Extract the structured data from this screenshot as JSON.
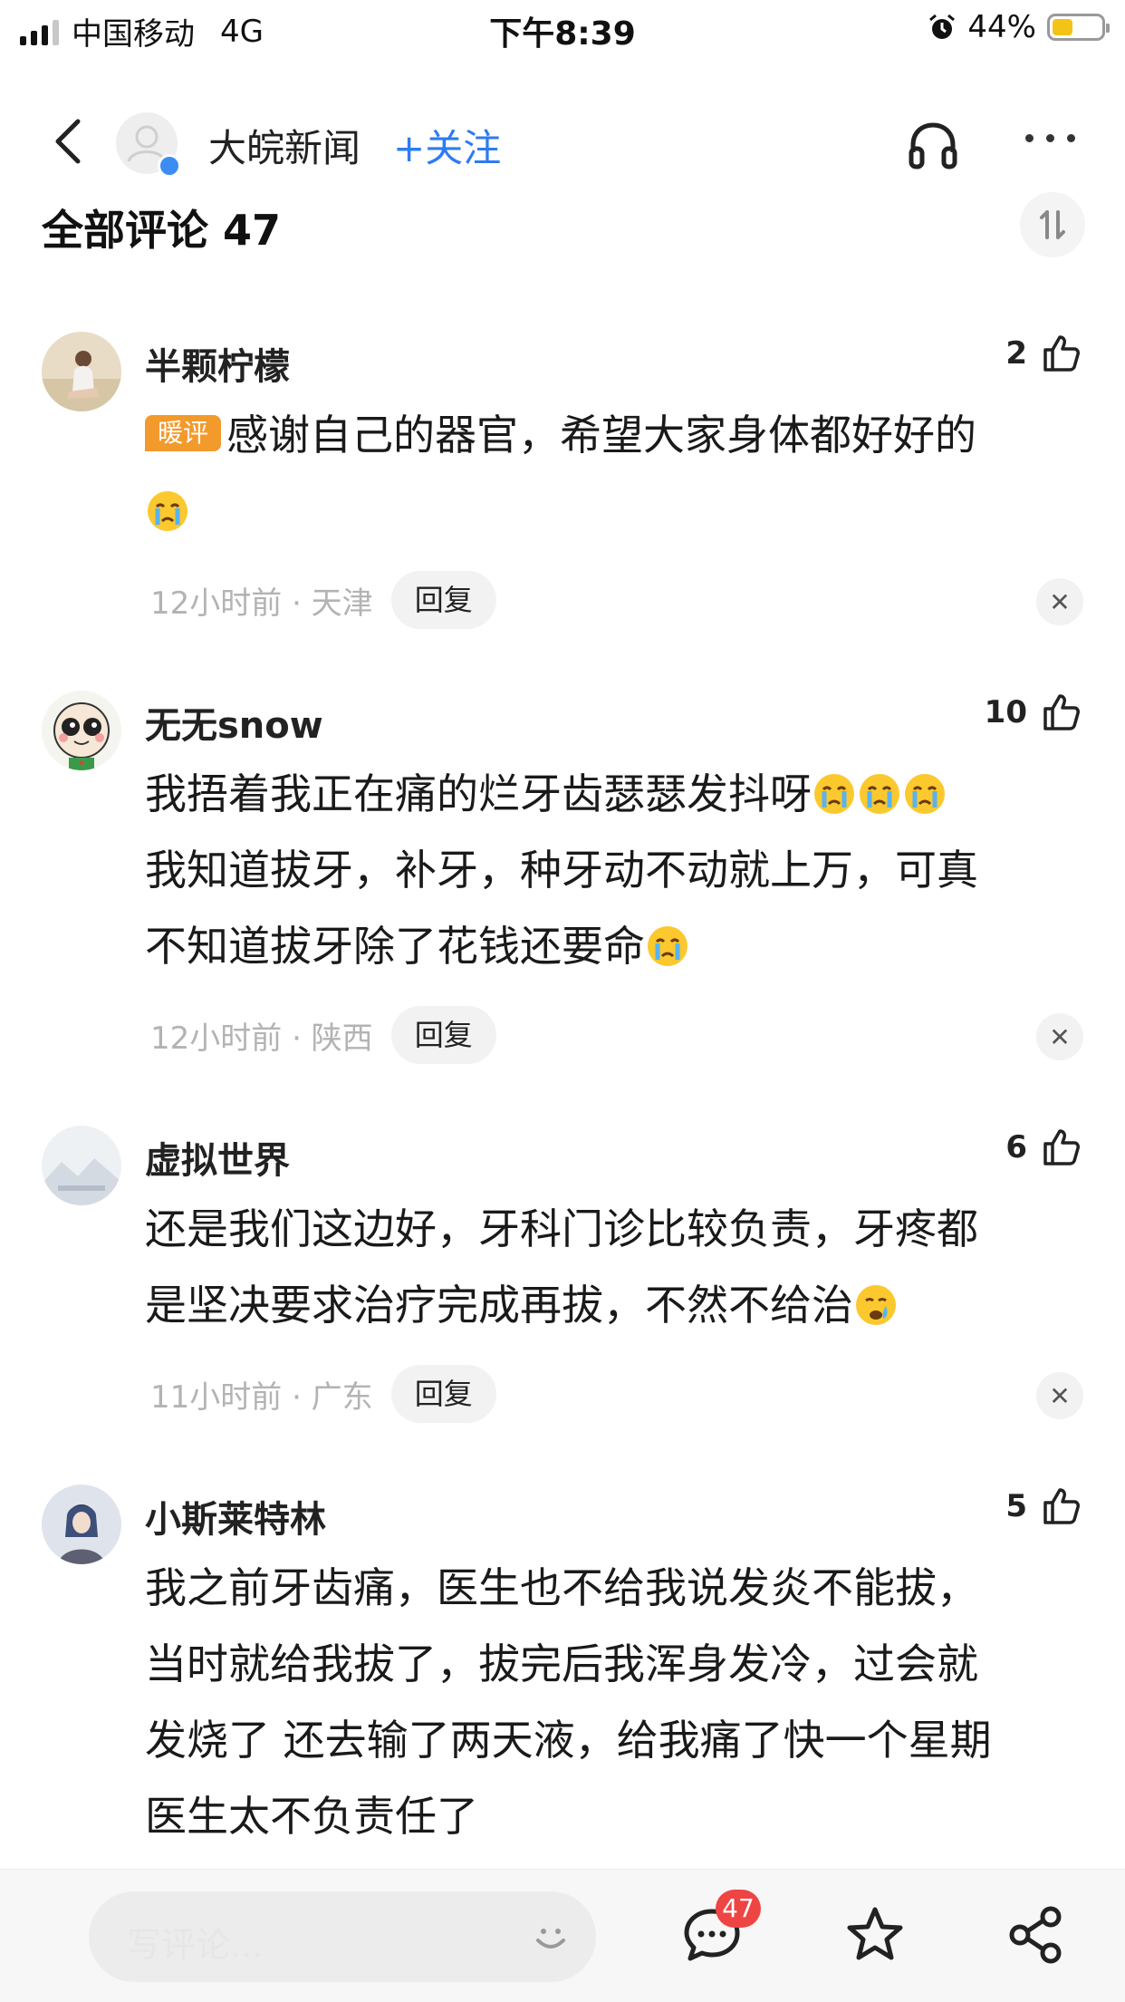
{
  "status_bar": {
    "carrier": "中国移动",
    "network": "4G",
    "time": "下午8:39",
    "battery": "44%"
  },
  "nav": {
    "title": "大皖新闻",
    "follow_label": "+关注"
  },
  "comments_header": "全部评论 47",
  "comments": [
    {
      "user": "半颗柠檬",
      "likes": "2",
      "tag": "暖评",
      "text": "感谢自己的器官，希望大家身体都好好的",
      "meta": "12小时前 · 天津",
      "reply_label": "回复"
    },
    {
      "user": "无无snow",
      "likes": "10",
      "text_line1": "我捂着我正在痛的烂牙齿瑟瑟发抖呀",
      "text_line2": "我知道拔牙，补牙，种牙动不动就上万，可真",
      "text_line3": "不知道拔牙除了花钱还要命",
      "meta": "12小时前 · 陕西",
      "reply_label": "回复"
    },
    {
      "user": "虚拟世界",
      "likes": "6",
      "text_line1": "还是我们这边好，牙科门诊比较负责，牙疼都",
      "text_line2": "是坚决要求治疗完成再拔，不然不给治",
      "meta": "11小时前 · 广东",
      "reply_label": "回复"
    },
    {
      "user": "小斯莱特林",
      "likes": "5",
      "text_line1": "我之前牙齿痛，医生也不给我说发炎不能拔，",
      "text_line2": "当时就给我拔了，拔完后我浑身发冷，过会就",
      "text_line3": "发烧了 还去输了两天液，给我痛了快一个星期",
      "text_line4": "医生太不负责任了"
    }
  ],
  "bottom_bar": {
    "input_placeholder": "写评论...",
    "comment_count": "47"
  },
  "colors": {
    "accent_blue": "#2d7bf2",
    "tag_orange": "#f39a2c",
    "badge_red": "#ef4444"
  },
  "icons": [
    "back-icon",
    "headphone-icon",
    "more-icon",
    "sort-icon",
    "thumb-up-icon",
    "crying-emoji-icon",
    "close-icon",
    "smile-icon",
    "comment-icon",
    "star-icon",
    "share-icon"
  ]
}
